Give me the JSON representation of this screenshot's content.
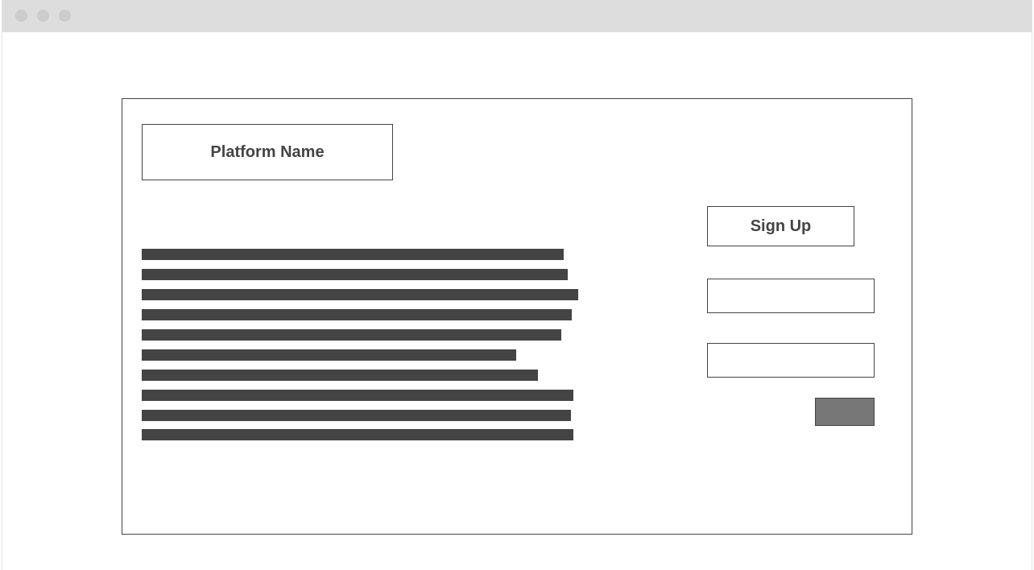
{
  "window": {
    "controls": [
      "close-dot",
      "minimize-dot",
      "maximize-dot"
    ]
  },
  "header": {
    "platform_name": "Platform Name"
  },
  "signup": {
    "title": "Sign Up",
    "field_1": {
      "value": "",
      "placeholder": ""
    },
    "field_2": {
      "value": "",
      "placeholder": ""
    },
    "submit_label": ""
  },
  "content": {
    "placeholder_line_count": 10
  },
  "colors": {
    "titlebar": "#dddddd",
    "window_dot": "#cccccc",
    "outline": "#444444",
    "text_placeholder": "#444444",
    "button_fill": "#777777",
    "background": "#ffffff"
  }
}
